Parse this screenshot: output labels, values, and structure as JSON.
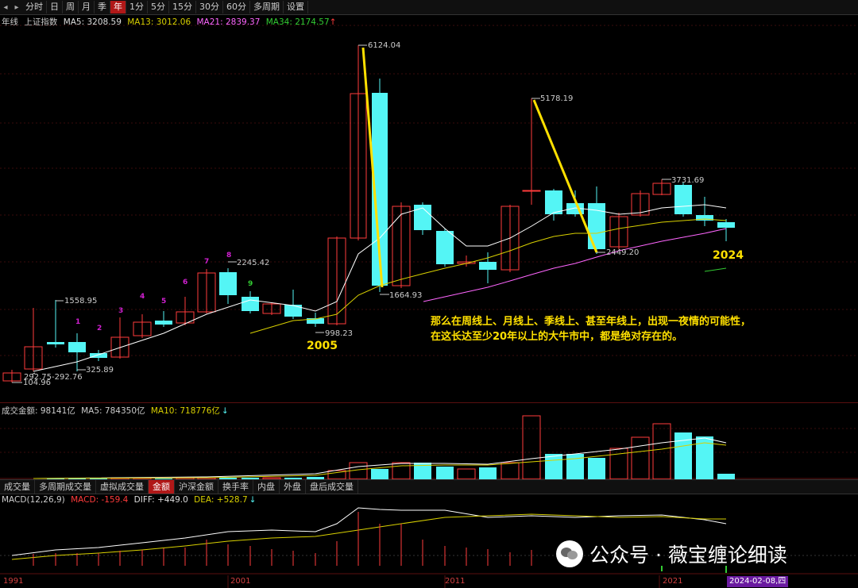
{
  "toolbar": {
    "tabs": [
      {
        "label": "分时"
      },
      {
        "label": "日"
      },
      {
        "label": "周"
      },
      {
        "label": "月"
      },
      {
        "label": "季"
      },
      {
        "label": "年",
        "active": true
      },
      {
        "label": "1分"
      },
      {
        "label": "5分"
      },
      {
        "label": "15分"
      },
      {
        "label": "30分"
      },
      {
        "label": "60分"
      },
      {
        "label": "多周期"
      },
      {
        "label": "设置"
      }
    ]
  },
  "main_info": {
    "period": "年线",
    "index_name": "上证指数",
    "ma5": "MA5: 3208.59",
    "ma13": "MA13: 3012.06",
    "ma21": "MA21: 2839.37",
    "ma34": "MA34: 2174.57",
    "arrow": "↑"
  },
  "volume_info": {
    "amount": "成交金额: 98141亿",
    "ma5": "MA5: 784350亿",
    "ma10": "MA10: 718776亿",
    "arrow": "↓"
  },
  "macd_info": {
    "title": "MACD(12,26,9)",
    "macd": "MACD: -159.4",
    "diff": "DIFF: +449.0",
    "dea": "DEA: +528.7",
    "arrow": "↓"
  },
  "sub_tabs": [
    {
      "label": "成交量"
    },
    {
      "label": "多周期成交量"
    },
    {
      "label": "虚拟成交量"
    },
    {
      "label": "金额",
      "active": true
    },
    {
      "label": "沪深金额"
    },
    {
      "label": "换手率"
    },
    {
      "label": "内盘"
    },
    {
      "label": "外盘"
    },
    {
      "label": "盘后成交量"
    }
  ],
  "price_labels": {
    "p104": "104.96",
    "p292": "292.75-292.76",
    "p325": "325.89",
    "p1558": "1558.95",
    "p2245": "2245.42",
    "p998": "998.23",
    "p6124": "6124.04",
    "p1664": "1664.93",
    "p5178": "5178.19",
    "p2449": "2449.20",
    "p3731": "3731.69"
  },
  "count_labels": [
    "1",
    "2",
    "3",
    "4",
    "5",
    "6",
    "7",
    "8",
    "9"
  ],
  "year_labels": {
    "y2005": "2005",
    "y2024": "2024"
  },
  "annotation": {
    "line1": "那么在周线上、月线上、季线上、甚至年线上，出现一夜情的可能性，",
    "line2": "在这长达至少20年以上的大牛市中，都是绝对存在的。"
  },
  "x_axis": [
    "1991",
    "2001",
    "2011",
    "2021"
  ],
  "date_badge": "2024-02-08,四",
  "watermark": "公众号 · 薇宝缠论细读",
  "colors": {
    "up": "#ff3b3b",
    "down": "#54f5f5",
    "ma5": "#ffffff",
    "ma13": "#d8d000",
    "ma21": "#ff66ff",
    "ma34": "#33cc33",
    "annotation": "#ffe000"
  },
  "chart_data": {
    "type": "candlestick",
    "title": "上证指数 年线",
    "years": [
      "1990",
      "1991",
      "1992",
      "1993",
      "1994",
      "1995",
      "1996",
      "1997",
      "1998",
      "1999",
      "2000",
      "2001",
      "2002",
      "2003",
      "2004",
      "2005",
      "2006",
      "2007",
      "2008",
      "2009",
      "2010",
      "2011",
      "2012",
      "2013",
      "2014",
      "2015",
      "2016",
      "2017",
      "2018",
      "2019",
      "2020",
      "2021",
      "2022",
      "2023",
      "2024"
    ],
    "labeled_points": {
      "1990_low": 104.96,
      "1992_high": 1558.95,
      "2000_high": 2245.42,
      "2005_low": 998.23,
      "2007_high": 6124.04,
      "2008_low": 1664.93,
      "2015_high": 5178.19,
      "2019_low": 2449.2,
      "2021_high": 3731.69
    },
    "ma": {
      "MA5": 3208.59,
      "MA13": 3012.06,
      "MA21": 2839.37,
      "MA34": 2174.57
    },
    "volume_amount_latest_yi": 98141,
    "macd": {
      "MACD": -159.4,
      "DIFF": 449.0,
      "DEA": 528.7
    }
  }
}
